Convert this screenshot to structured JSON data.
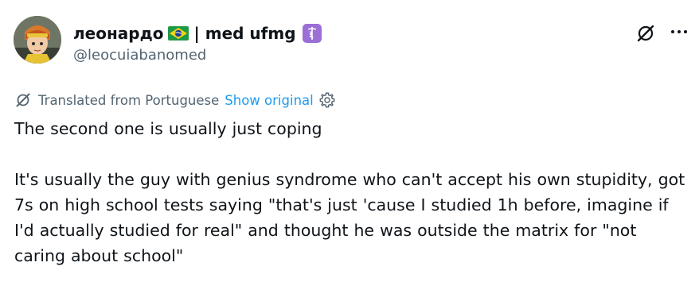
{
  "author": {
    "display_name": "леонардо",
    "separator": " | med ufmg",
    "handle": "@leocuiabanomed",
    "flag_icon": "brazil-flag-icon",
    "badge_icon": "caduceus-icon",
    "badge_color": "#9b6fd6"
  },
  "actions": {
    "grok_icon": "grok-icon",
    "more_icon": "more-icon"
  },
  "translation": {
    "note": "Translated from Portuguese",
    "show_original": "Show original",
    "settings_icon": "gear-icon"
  },
  "tweet": {
    "text": "The second one is usually just coping\n\nIt's usually the guy with genius syndrome who can't accept his own stupidity, got 7s on high school tests saying \"that's just 'cause I studied 1h before, imagine if I'd actually studied for real\" and thought he was outside the matrix for \"not caring about school\""
  },
  "colors": {
    "link": "#1d9bf0",
    "secondary_text": "#536471",
    "primary_text": "#0f1419"
  }
}
